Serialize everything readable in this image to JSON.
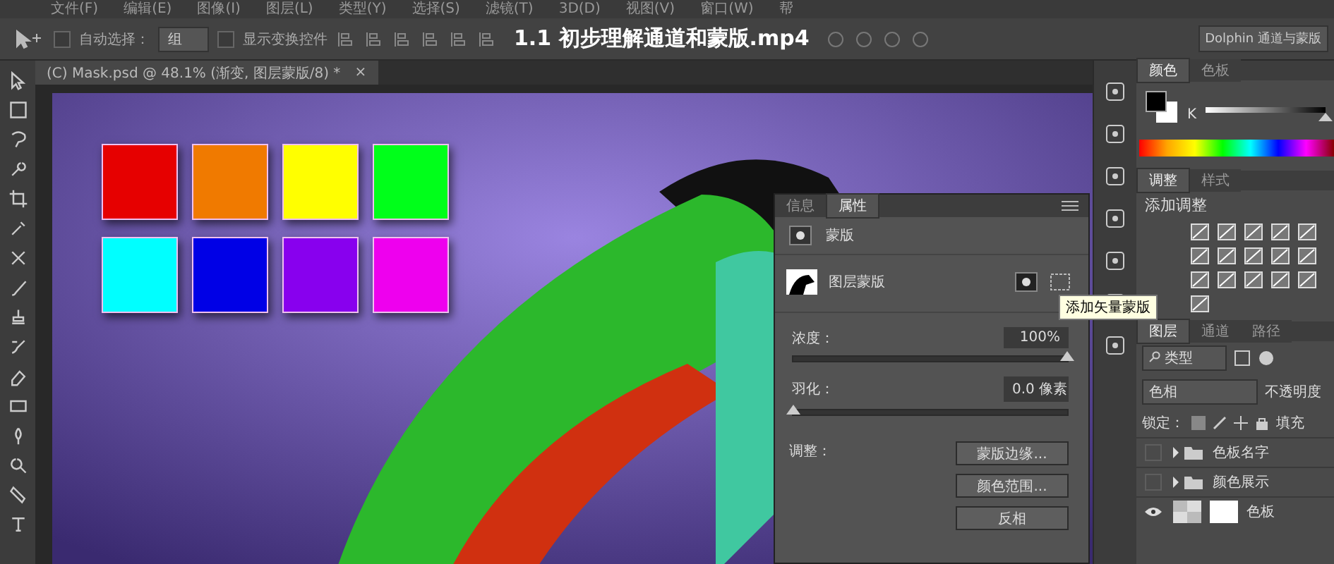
{
  "menu": [
    "文件(F)",
    "编辑(E)",
    "图像(I)",
    "图层(L)",
    "类型(Y)",
    "选择(S)",
    "滤镜(T)",
    "3D(D)",
    "视图(V)",
    "窗口(W)",
    "帮"
  ],
  "options_bar": {
    "auto_select": {
      "label": "自动选择：",
      "checked": false
    },
    "auto_select_target": "组",
    "transform_controls": {
      "label": "显示变换控件",
      "checked": false
    },
    "workspace": "Dolphin 通道与蒙版"
  },
  "video_title": "1.1 初步理解通道和蒙版.mp4",
  "document_tab": {
    "title": "(C) Mask.psd @ 48.1% (渐变, 图层蒙版/8) *",
    "close": "×"
  },
  "canvas": {
    "swatches": [
      {
        "color": "#e60000"
      },
      {
        "color": "#f07a00"
      },
      {
        "color": "#ffff00"
      },
      {
        "color": "#00ff1a"
      },
      {
        "color": "#00ffff"
      },
      {
        "color": "#0000e6"
      },
      {
        "color": "#8800ee"
      },
      {
        "color": "#ee00ee"
      }
    ]
  },
  "properties_panel": {
    "tabs": [
      {
        "label": "信息",
        "selected": false
      },
      {
        "label": "属性",
        "selected": true
      }
    ],
    "section": "蒙版",
    "mask_name": "图层蒙版",
    "tooltip": "添加矢量蒙版",
    "density": {
      "label": "浓度：",
      "value": "100%",
      "level": 1
    },
    "feather": {
      "label": "羽化：",
      "value": "0.0 像素",
      "level": 0
    },
    "adjust_label": "调整：",
    "buttons": [
      "蒙版边缘...",
      "颜色范围...",
      "反相"
    ]
  },
  "color_panel": {
    "tabs": [
      {
        "label": "颜色",
        "selected": true
      },
      {
        "label": "色板",
        "selected": false
      }
    ],
    "channel": "K",
    "level": 1
  },
  "adjustments_panel": {
    "tabs": [
      {
        "label": "调整",
        "selected": true
      },
      {
        "label": "样式",
        "selected": false
      }
    ],
    "title": "添加调整"
  },
  "layers_panel": {
    "tabs": [
      {
        "label": "图层",
        "selected": true
      },
      {
        "label": "通道",
        "selected": false
      },
      {
        "label": "路径",
        "selected": false
      }
    ],
    "filter": "类型",
    "blend_mode": "色相",
    "opacity_label": "不透明度",
    "lock_label": "锁定：",
    "fill_label": "填充",
    "layers": [
      {
        "name": "色板名字",
        "kind": "group",
        "visible": false
      },
      {
        "name": "颜色展示",
        "kind": "group",
        "visible": false
      },
      {
        "name": "色板",
        "kind": "masked",
        "visible": true
      }
    ]
  }
}
